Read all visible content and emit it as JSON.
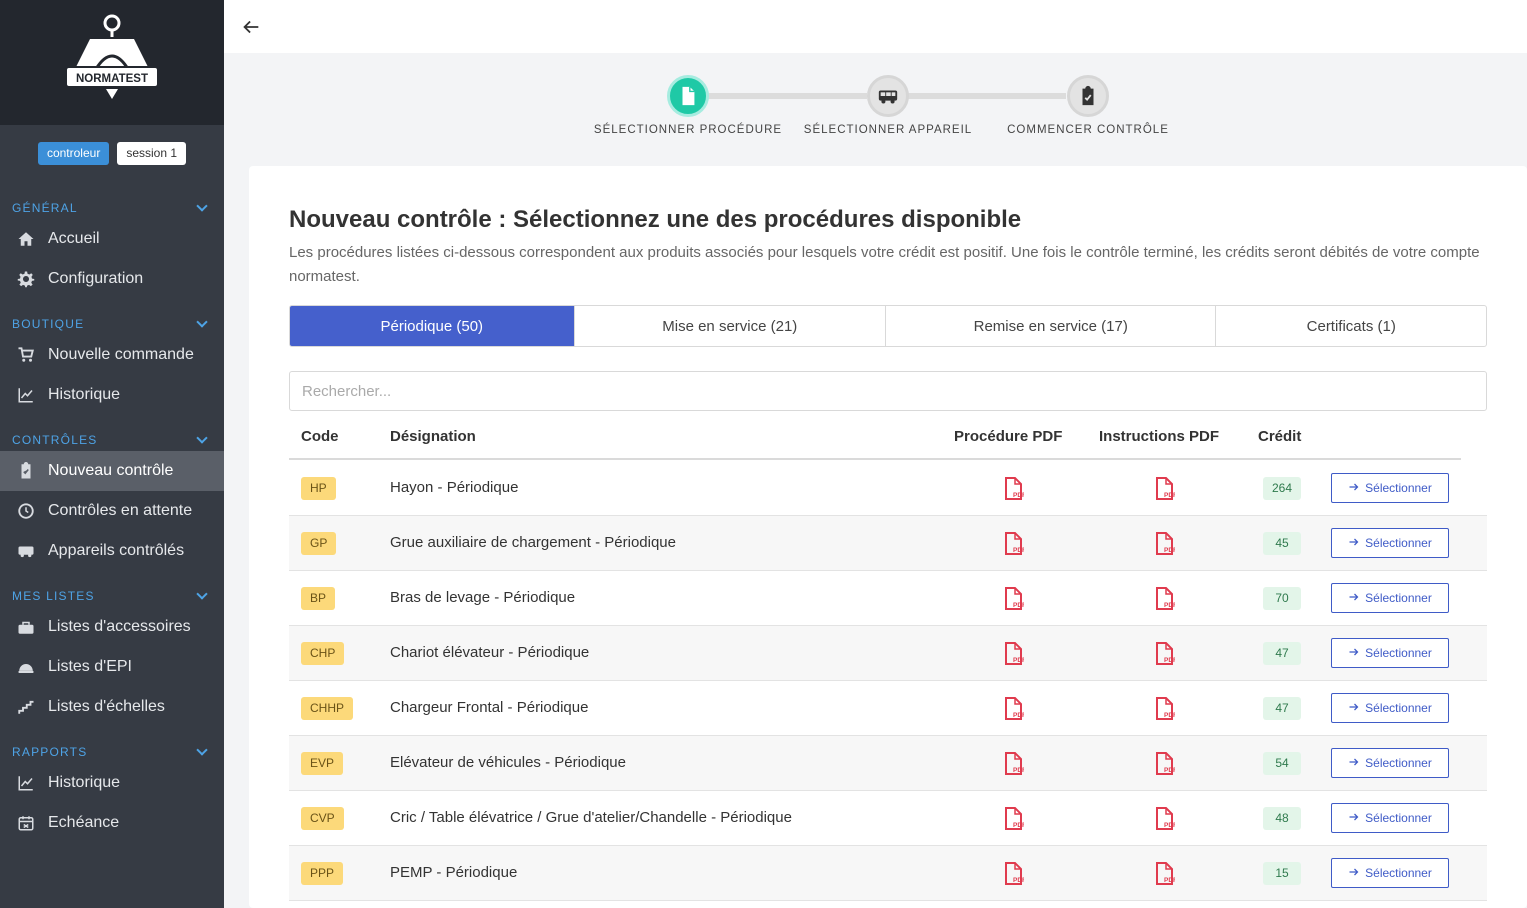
{
  "brand": {
    "logo_text": "NORMATEST"
  },
  "badges": {
    "role": "controleur",
    "session": "session 1"
  },
  "sidebar": {
    "sections": [
      {
        "title": "GÉNÉRAL",
        "items": [
          {
            "label": "Accueil",
            "icon": "home-icon"
          },
          {
            "label": "Configuration",
            "icon": "gear-icon"
          }
        ]
      },
      {
        "title": "BOUTIQUE",
        "items": [
          {
            "label": "Nouvelle commande",
            "icon": "cart-icon"
          },
          {
            "label": "Historique",
            "icon": "chart-line-icon"
          }
        ]
      },
      {
        "title": "CONTRÔLES",
        "items": [
          {
            "label": "Nouveau contrôle",
            "icon": "clipboard-check-icon",
            "active": true
          },
          {
            "label": "Contrôles en attente",
            "icon": "clock-icon"
          },
          {
            "label": "Appareils contrôlés",
            "icon": "truck-icon"
          }
        ]
      },
      {
        "title": "MES LISTES",
        "items": [
          {
            "label": "Listes d'accessoires",
            "icon": "toolbox-icon"
          },
          {
            "label": "Listes d'EPI",
            "icon": "hard-hat-icon"
          },
          {
            "label": "Listes d'échelles",
            "icon": "stairs-icon"
          }
        ]
      },
      {
        "title": "RAPPORTS",
        "items": [
          {
            "label": "Historique",
            "icon": "chart-line-icon"
          },
          {
            "label": "Echéance",
            "icon": "calendar-icon"
          }
        ]
      }
    ]
  },
  "stepper": {
    "steps": [
      {
        "label": "SÉLECTIONNER PROCÉDURE",
        "icon": "file-icon",
        "active": true
      },
      {
        "label": "SÉLECTIONNER APPAREIL",
        "icon": "van-icon",
        "active": false
      },
      {
        "label": "COMMENCER CONTRÔLE",
        "icon": "clipboard-icon",
        "active": false
      }
    ]
  },
  "main": {
    "title": "Nouveau contrôle : Sélectionnez une des procédures disponible",
    "description": "Les procédures listées ci-dessous correspondent aux produits associés pour lesquels votre crédit est positif. Une fois le contrôle terminé, les crédits seront débités de votre compte normatest.",
    "tabs": [
      {
        "label": "Périodique (50)",
        "active": true
      },
      {
        "label": "Mise en service (21)",
        "active": false
      },
      {
        "label": "Remise en service (17)",
        "active": false
      },
      {
        "label": "Certificats (1)",
        "active": false
      }
    ],
    "search_placeholder": "Rechercher...",
    "columns": {
      "code": "Code",
      "designation": "Désignation",
      "procedure_pdf": "Procédure PDF",
      "instructions_pdf": "Instructions PDF",
      "credit": "Crédit"
    },
    "select_label": "Sélectionner",
    "rows": [
      {
        "code": "HP",
        "designation": "Hayon - Périodique",
        "credit": "264"
      },
      {
        "code": "GP",
        "designation": "Grue auxiliaire de chargement - Périodique",
        "credit": "45"
      },
      {
        "code": "BP",
        "designation": "Bras de levage - Périodique",
        "credit": "70"
      },
      {
        "code": "CHP",
        "designation": "Chariot élévateur - Périodique",
        "credit": "47"
      },
      {
        "code": "CHHP",
        "designation": "Chargeur Frontal - Périodique",
        "credit": "47"
      },
      {
        "code": "EVP",
        "designation": "Elévateur de véhicules - Périodique",
        "credit": "54"
      },
      {
        "code": "CVP",
        "designation": "Cric / Table élévatrice / Grue d'atelier/Chandelle - Périodique",
        "credit": "48"
      },
      {
        "code": "PPP",
        "designation": "PEMP - Périodique",
        "credit": "15"
      }
    ]
  },
  "colors": {
    "accent": "#4560cc",
    "sidebar": "#363b44",
    "step_active": "#1fc9a6",
    "pdf": "#e03b4e"
  }
}
